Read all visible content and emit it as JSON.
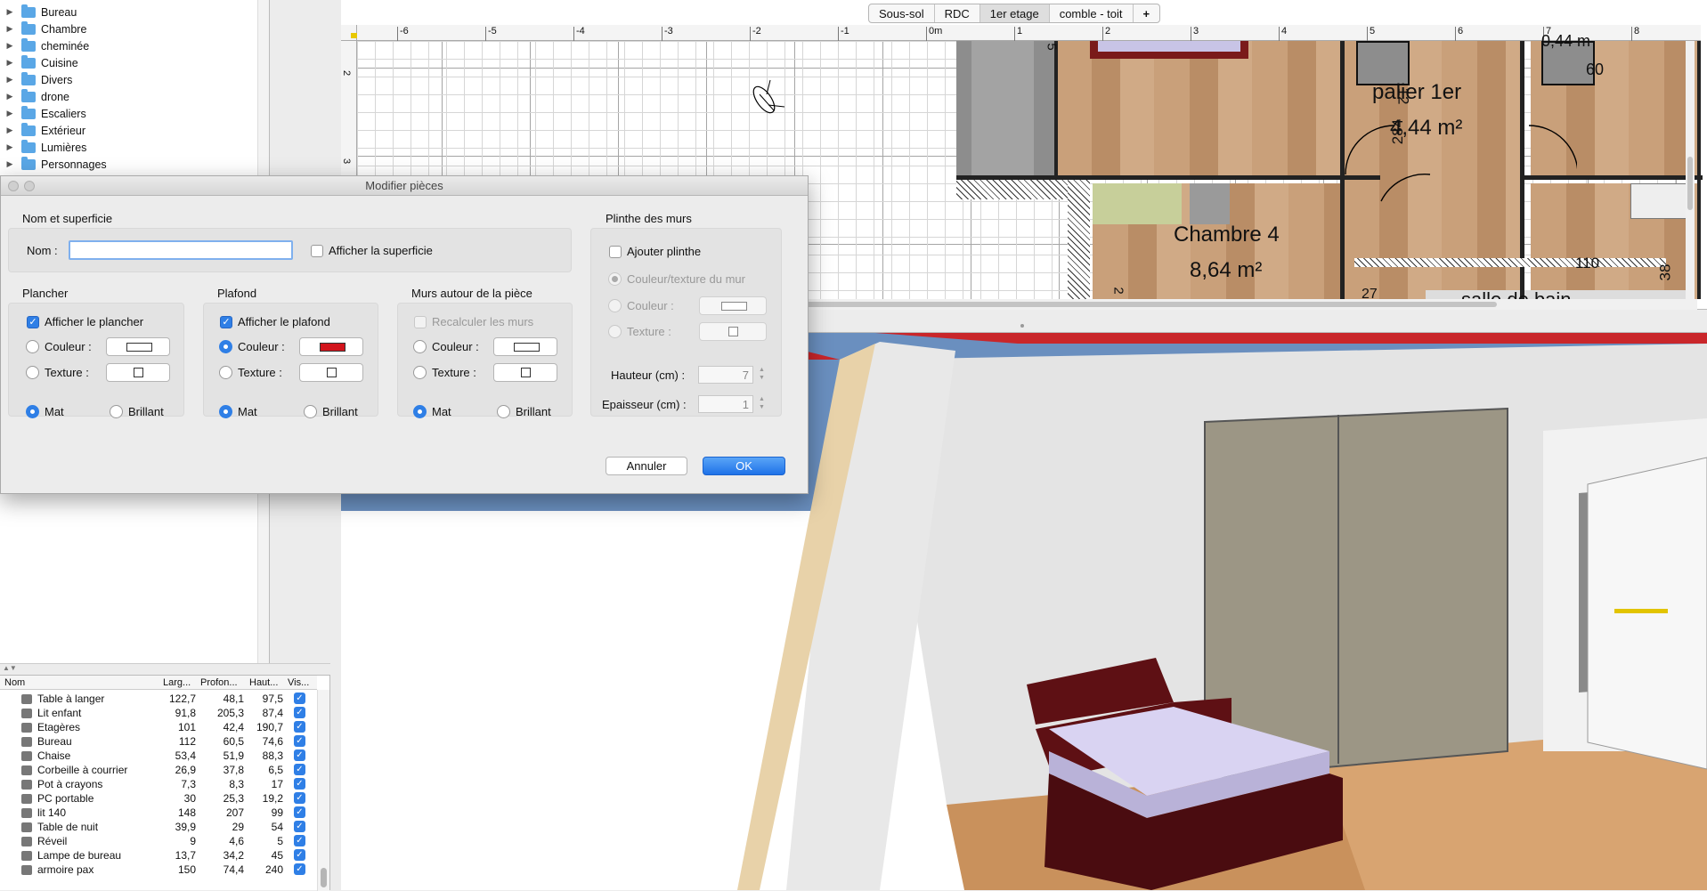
{
  "catalog": {
    "categories": [
      "Bureau",
      "Chambre",
      "cheminée",
      "Cuisine",
      "Divers",
      "drone",
      "Escaliers",
      "Extérieur",
      "Lumières",
      "Personnages"
    ]
  },
  "levels": {
    "tabs": [
      "Sous-sol",
      "RDC",
      "1er etage",
      "comble - toit",
      "+"
    ],
    "selected": "1er etage"
  },
  "plan": {
    "ruler_h": [
      "-6",
      "-5",
      "-4",
      "-3",
      "-2",
      "-1",
      "0m",
      "1",
      "2",
      "3",
      "4",
      "5",
      "6",
      "7",
      "8"
    ],
    "ruler_v": [
      "2",
      "3"
    ],
    "rooms": [
      {
        "name": "palier 1er",
        "area": "4,44 m²"
      },
      {
        "name": "Chambre 4",
        "area": "8,64 m²"
      },
      {
        "name": "salle de bain",
        "area": ""
      }
    ],
    "dims": [
      "60",
      "110",
      "38",
      "5",
      "2",
      "12",
      "284",
      "27",
      "0,44 m"
    ]
  },
  "dialog": {
    "title": "Modifier pièces",
    "name_section": {
      "label": "Nom et superficie",
      "name_label": "Nom :",
      "name_value": "",
      "show_area": "Afficher la superficie"
    },
    "floor": {
      "label": "Plancher",
      "show": "Afficher le plancher",
      "color": "Couleur :",
      "texture": "Texture :",
      "matt": "Mat",
      "shiny": "Brillant"
    },
    "ceiling": {
      "label": "Plafond",
      "show": "Afficher le plafond",
      "color": "Couleur :",
      "texture": "Texture :",
      "matt": "Mat",
      "shiny": "Brillant",
      "color_value": "#d2141c"
    },
    "walls": {
      "label": "Murs autour de la pièce",
      "recalc": "Recalculer les murs",
      "color": "Couleur :",
      "texture": "Texture :",
      "matt": "Mat",
      "shiny": "Brillant"
    },
    "baseboard": {
      "label": "Plinthe des murs",
      "add": "Ajouter plinthe",
      "wall_color": "Couleur/texture du mur",
      "color": "Couleur :",
      "texture": "Texture :",
      "height_label": "Hauteur (cm) :",
      "height_value": "7",
      "thickness_label": "Epaisseur (cm) :",
      "thickness_value": "1"
    },
    "cancel": "Annuler",
    "ok": "OK"
  },
  "furniture": {
    "headers": [
      "Nom",
      "Larg...",
      "Profon...",
      "Haut...",
      "Vis..."
    ],
    "rows": [
      {
        "name": "Table à langer",
        "w": "122,7",
        "d": "48,1",
        "h": "97,5"
      },
      {
        "name": "Lit enfant",
        "w": "91,8",
        "d": "205,3",
        "h": "87,4"
      },
      {
        "name": "Etagères",
        "w": "101",
        "d": "42,4",
        "h": "190,7"
      },
      {
        "name": "Bureau",
        "w": "112",
        "d": "60,5",
        "h": "74,6"
      },
      {
        "name": "Chaise",
        "w": "53,4",
        "d": "51,9",
        "h": "88,3"
      },
      {
        "name": "Corbeille à courrier",
        "w": "26,9",
        "d": "37,8",
        "h": "6,5"
      },
      {
        "name": "Pot à crayons",
        "w": "7,3",
        "d": "8,3",
        "h": "17"
      },
      {
        "name": "PC portable",
        "w": "30",
        "d": "25,3",
        "h": "19,2"
      },
      {
        "name": "lit 140",
        "w": "148",
        "d": "207",
        "h": "99"
      },
      {
        "name": "Table de nuit",
        "w": "39,9",
        "d": "29",
        "h": "54"
      },
      {
        "name": "Réveil",
        "w": "9",
        "d": "4,6",
        "h": "5"
      },
      {
        "name": "Lampe de bureau",
        "w": "13,7",
        "d": "34,2",
        "h": "45"
      },
      {
        "name": "armoire pax",
        "w": "150",
        "d": "74,4",
        "h": "240"
      }
    ]
  },
  "colors": {
    "accent": "#2f7fe6",
    "ceiling": "#d2141c",
    "floor_wood": "#c9a07a"
  }
}
